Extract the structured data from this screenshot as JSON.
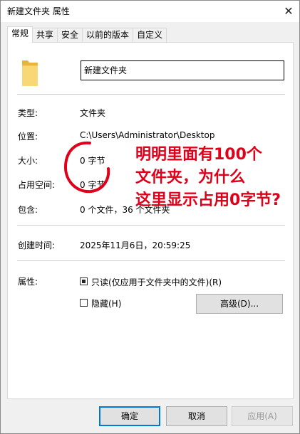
{
  "window": {
    "title": "新建文件夹 属性",
    "close_glyph": "✕"
  },
  "tabs": [
    {
      "label": "常规",
      "active": true
    },
    {
      "label": "共享",
      "active": false
    },
    {
      "label": "安全",
      "active": false
    },
    {
      "label": "以前的版本",
      "active": false
    },
    {
      "label": "自定义",
      "active": false
    }
  ],
  "general": {
    "folder_name": "新建文件夹",
    "type_label": "类型:",
    "type_value": "文件夹",
    "location_label": "位置:",
    "location_value": "C:\\Users\\Administrator\\Desktop",
    "size_label": "大小:",
    "size_value": "0 字节",
    "size_on_disk_label": "占用空间:",
    "size_on_disk_value": "0 字节",
    "contains_label": "包含:",
    "contains_value": "0 个文件，36 个文件夹",
    "created_label": "创建时间:",
    "created_value": "2025年11月6日，20:59:25",
    "attributes_label": "属性:",
    "readonly_label": "只读(仅应用于文件夹中的文件)(R)",
    "readonly_checked": true,
    "hidden_label": "隐藏(H)",
    "hidden_checked": false,
    "advanced_label": "高级(D)..."
  },
  "buttons": {
    "ok": "确定",
    "cancel": "取消",
    "apply": "应用(A)"
  },
  "annotation": {
    "lines": [
      "明明里面有100个",
      "文件夹，为什么",
      "这里显示占用0字节?"
    ],
    "color": "#e0001a"
  },
  "icons": {
    "folder": "folder-icon",
    "close": "close-icon"
  }
}
